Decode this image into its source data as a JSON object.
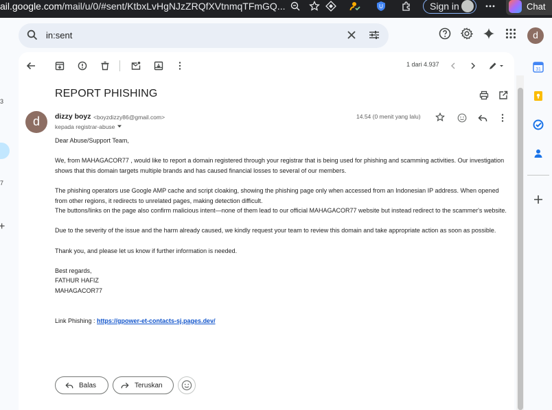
{
  "browser": {
    "url_domain": "ail.google.com",
    "url_path": "/mail/u/0/#sent/KtbxLvHgNJzZRQfXVtnmqTFmGQ...",
    "signin_label": "Sign in",
    "chat_label": "Chat"
  },
  "search": {
    "query": "in:sent"
  },
  "account": {
    "avatar_letter": "d"
  },
  "left_strip": {
    "counts": [
      "3",
      "7"
    ]
  },
  "toolbar": {
    "count": "1 dari 4.937"
  },
  "email": {
    "subject": "REPORT PHISHING",
    "sender_name": "dizzy boyz",
    "sender_email": "<boyzdizzy86@gmail.com>",
    "avatar_letter": "d",
    "to_line": "kepada registrar-abuse",
    "timestamp": "14.54 (0 menit yang lalu)",
    "greeting": "Dear Abuse/Support Team,",
    "para1": "We, from MAHAGACOR77 , would like to report a domain registered through your registrar that is being used for phishing and scamming activities. Our investigation shows that this domain targets multiple brands and has caused financial losses to several of our members.",
    "para2a": "The phishing operators use Google AMP cache and script cloaking, showing the phishing page only when accessed from an Indonesian IP address. When opened from other regions, it redirects to unrelated pages, making detection difficult.",
    "para2b": "The buttons/links on the page also confirm malicious intent—none of them lead to our official MAHAGACOR77 website but instead redirect to the scammer's website.",
    "para3": "Due to the severity of the issue and the harm already caused, we kindly request your team to review this domain and take appropriate action as soon as possible.",
    "para4": "Thank you, and please let us know if further information is needed.",
    "sign1": "Best regards,",
    "sign2": "FATHUR HAFIZ",
    "sign3": "MAHAGACOR77",
    "link_label": "Link Phishing : ",
    "link_url": "https://gpower-et-contacts-sj.pages.dev/"
  },
  "actions": {
    "reply_label": "Balas",
    "forward_label": "Teruskan"
  },
  "colors": {
    "accent": "#0b57d0",
    "link": "#1155cc",
    "search_bg": "#e9eef6",
    "nav_active": "#c2e7ff"
  }
}
